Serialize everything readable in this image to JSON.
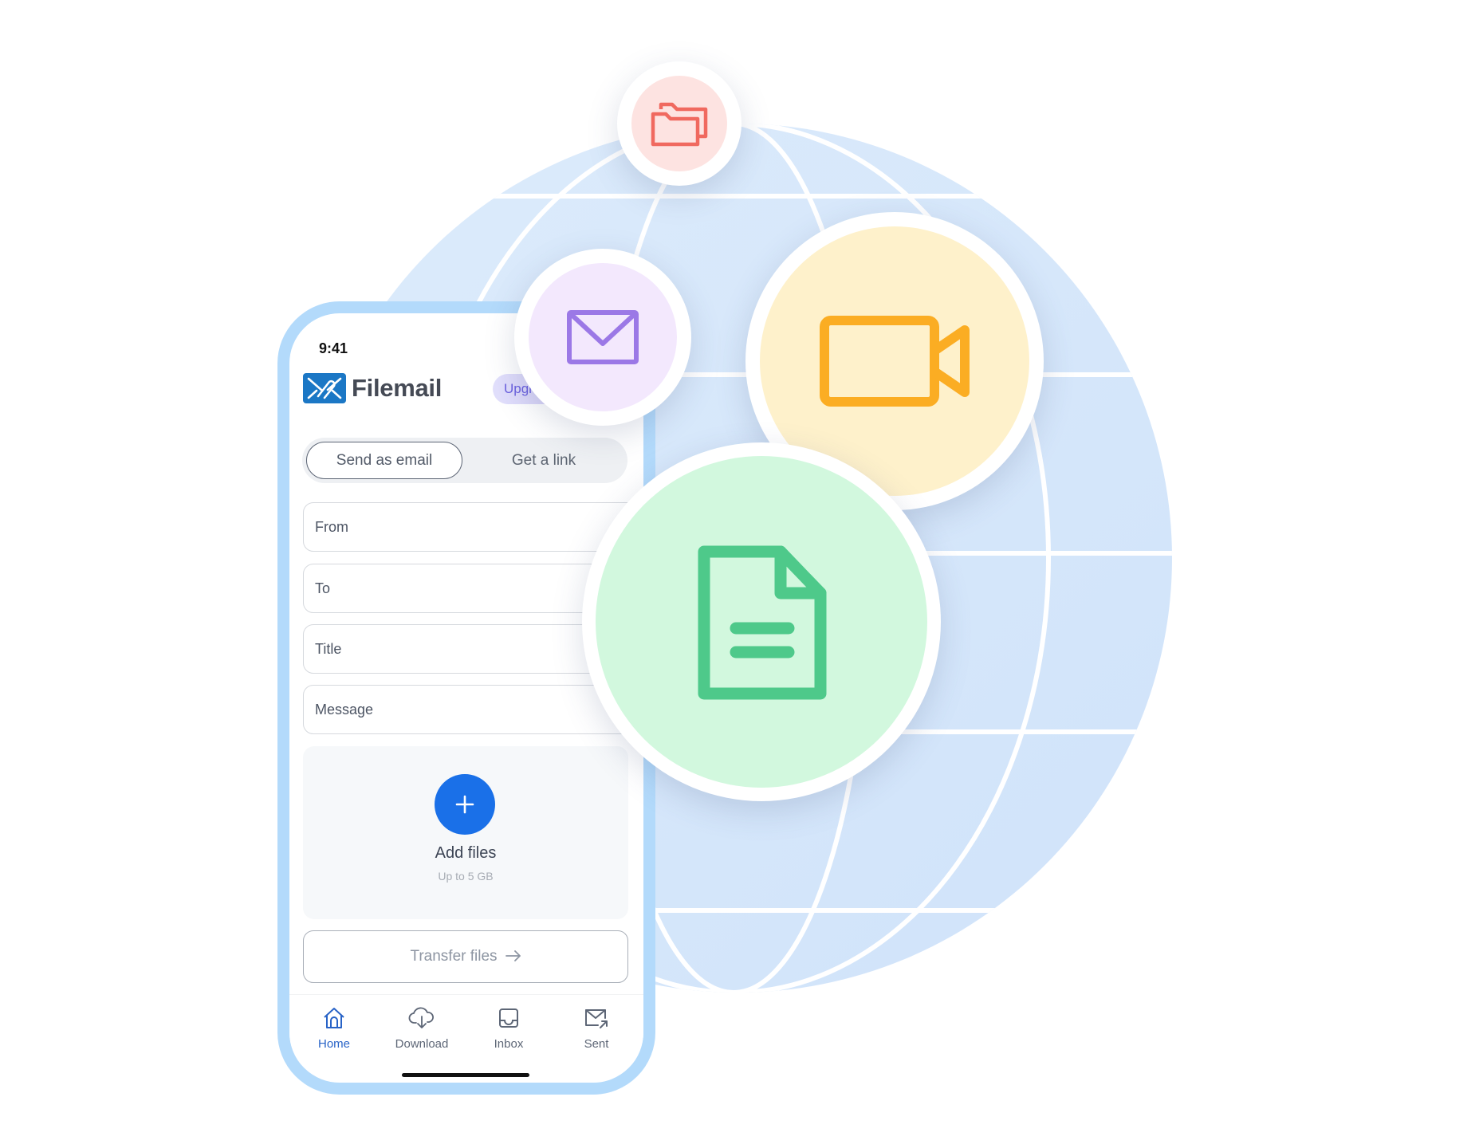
{
  "phone": {
    "status_time": "9:41",
    "brand": "Filemail",
    "upgrade_label": "Upgrade",
    "segments": [
      {
        "label": "Send as email",
        "active": true
      },
      {
        "label": "Get a link",
        "active": false
      }
    ],
    "fields": [
      {
        "placeholder": "From",
        "value": ""
      },
      {
        "placeholder": "To",
        "value": ""
      },
      {
        "placeholder": "Title",
        "value": ""
      },
      {
        "placeholder": "Message",
        "value": ""
      }
    ],
    "dropzone": {
      "icon": "plus-icon",
      "label": "Add files",
      "sublabel": "Up to 5 GB"
    },
    "transfer_button": {
      "label": "Transfer files",
      "icon": "arrow-right-icon"
    },
    "nav": [
      {
        "label": "Home",
        "icon": "home-icon",
        "active": true
      },
      {
        "label": "Download",
        "icon": "cloud-download-icon",
        "active": false
      },
      {
        "label": "Inbox",
        "icon": "inbox-icon",
        "active": false
      },
      {
        "label": "Sent",
        "icon": "mail-sent-icon",
        "active": false
      }
    ]
  },
  "illustration": {
    "globe_color": "#d5e6fb",
    "bubbles": [
      {
        "icon": "folders-icon",
        "bg": "#fde3e1",
        "stroke": "#f0695f"
      },
      {
        "icon": "envelope-icon",
        "bg": "#f3e8fd",
        "stroke": "#9b78e6"
      },
      {
        "icon": "video-camera-icon",
        "bg": "#fef1cb",
        "stroke": "#fbad23"
      },
      {
        "icon": "document-icon",
        "bg": "#d2f8de",
        "stroke": "#4ec98a"
      }
    ]
  },
  "colors": {
    "brand_blue": "#1b77c5",
    "primary": "#1a70e8",
    "phone_frame": "#b3dafb",
    "nav_active": "#2863c7"
  }
}
